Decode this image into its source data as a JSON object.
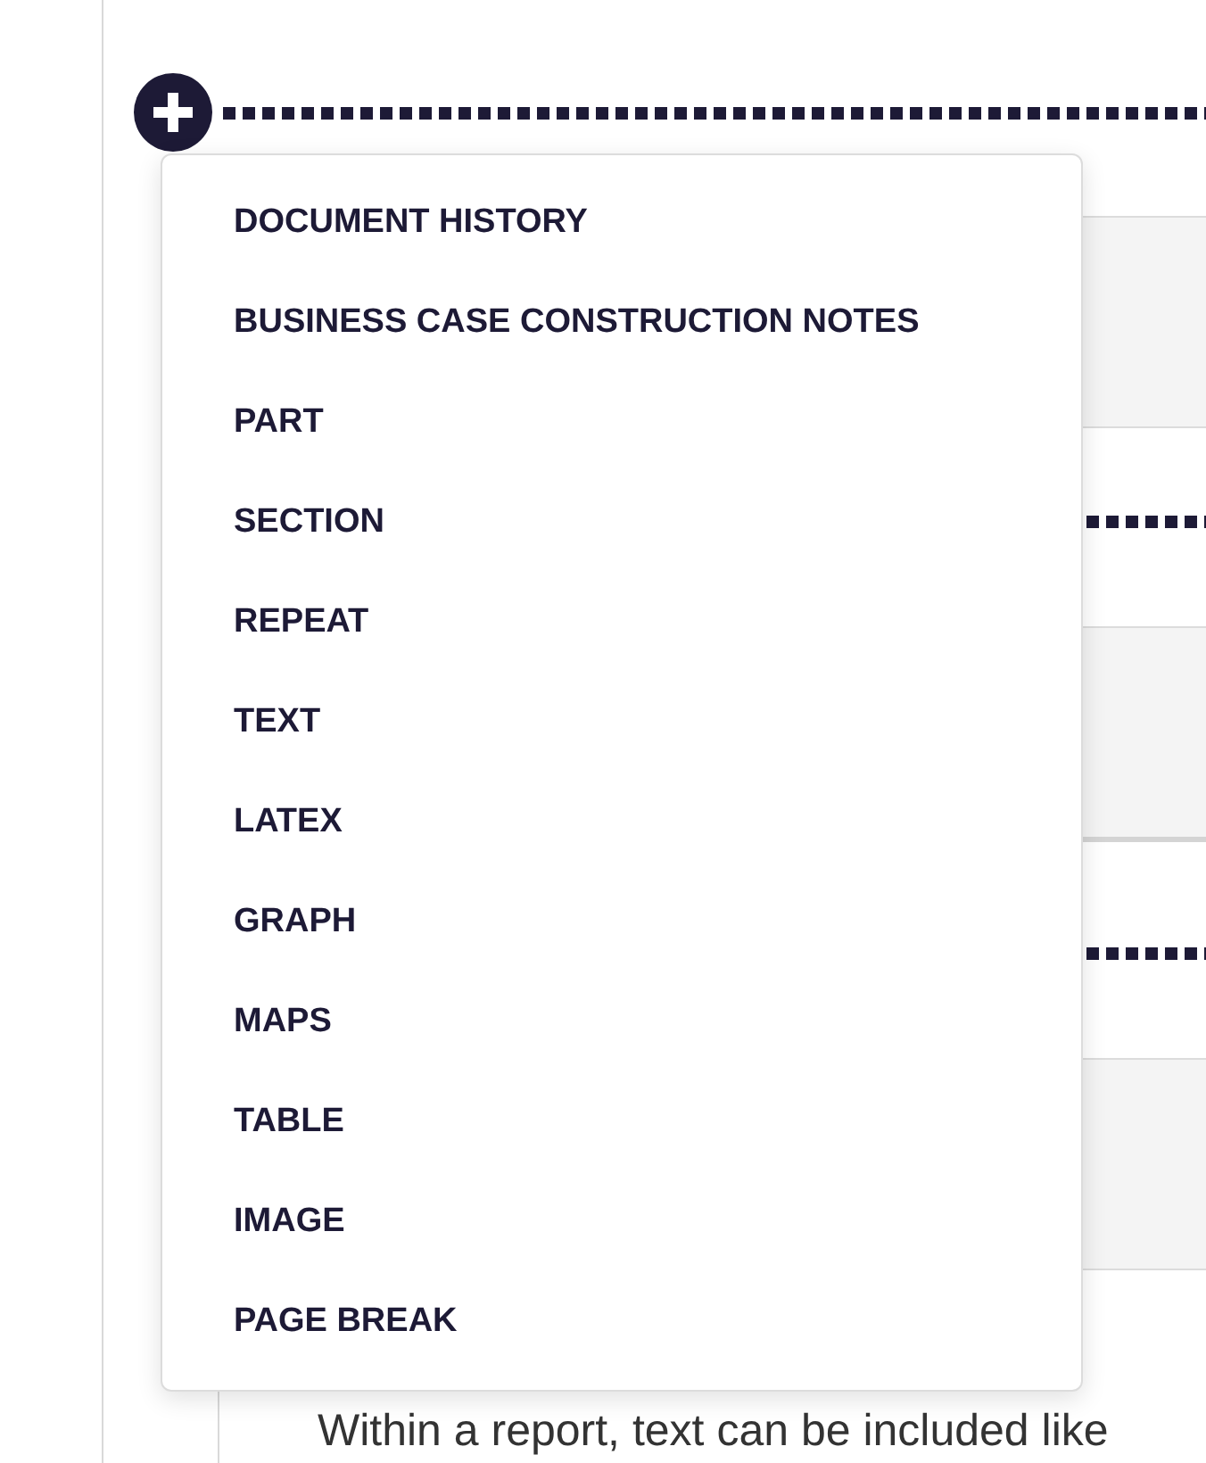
{
  "insert_menu": {
    "items": [
      "DOCUMENT HISTORY",
      "BUSINESS CASE CONSTRUCTION NOTES",
      "PART",
      "SECTION",
      "REPEAT",
      "TEXT",
      "LATEX",
      "GRAPH",
      "MAPS",
      "TABLE",
      "IMAGE",
      "PAGE BREAK"
    ]
  },
  "content": {
    "paragraph_lines": [
      "Within a report, text can be included like"
    ]
  }
}
